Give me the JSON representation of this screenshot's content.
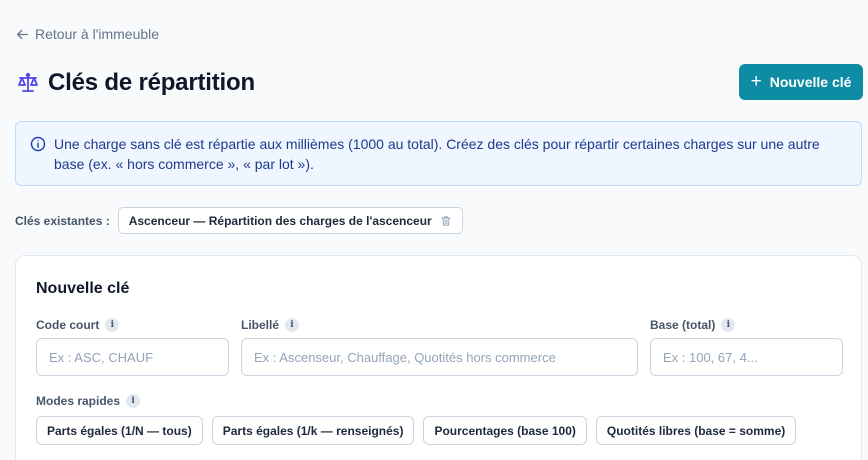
{
  "nav": {
    "back_label": "Retour à l'immeuble"
  },
  "header": {
    "title": "Clés de répartition",
    "new_button_label": "Nouvelle clé"
  },
  "info": {
    "text": "Une charge sans clé est répartie aux millièmes (1000 au total). Créez des clés pour répartir certaines charges sur une autre base (ex. « hors commerce », « par lot »)."
  },
  "existing": {
    "label": "Clés existantes :",
    "keys": [
      {
        "label": "Ascenceur — Répartition des charges de l'ascenceur"
      }
    ]
  },
  "form": {
    "title": "Nouvelle clé",
    "code": {
      "label": "Code court",
      "value": "",
      "placeholder": "Ex : ASC, CHAUF"
    },
    "libelle": {
      "label": "Libellé",
      "value": "",
      "placeholder": "Ex : Ascenseur, Chauffage, Quotités hors commerce"
    },
    "base": {
      "label": "Base (total)",
      "value": "",
      "placeholder": "Ex : 100, 67, 4..."
    },
    "modes": {
      "label": "Modes rapides",
      "items": [
        {
          "label": "Parts égales (1/N — tous)"
        },
        {
          "label": "Parts égales (1/k — renseignés)"
        },
        {
          "label": "Pourcentages (base 100)"
        },
        {
          "label": "Quotités libres (base = somme)"
        }
      ]
    },
    "info_glyph": "i"
  },
  "colors": {
    "accent": "#0e8ca3",
    "icon": "#4f46e5",
    "info_bg": "#eff6ff",
    "info_text": "#1e3a8a"
  },
  "icons": {
    "back": "arrow-left-icon",
    "title": "scale-icon",
    "info": "info-circle-icon",
    "delete": "trash-icon"
  }
}
